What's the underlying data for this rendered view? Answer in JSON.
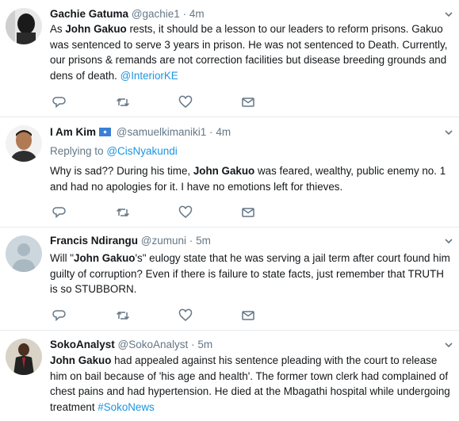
{
  "tweets": [
    {
      "name": "Gachie Gatuma",
      "handle": "@gachie1",
      "sep": "·",
      "time": "4m",
      "text_parts": [
        "As ",
        "John Gakuo",
        " rests, it should be a lesson to our leaders to reform prisons. Gakuo was sentenced to serve 3 years in prison. He was not sentenced to Death. Currently, our prisons & remands are not correction facilities but disease breeding grounds and dens of death. ",
        "@InteriorKE"
      ]
    },
    {
      "name": "I Am Kim",
      "handle": "@samuelkimaniki1",
      "sep": "·",
      "time": "4m",
      "replying_label": "Replying to",
      "replying_to": "@CisNyakundi",
      "text_parts": [
        "Why is sad?? During his time, ",
        "John Gakuo",
        " was feared, wealthy, public enemy no. 1 and had no apologies for it. I have no emotions left for thieves."
      ]
    },
    {
      "name": "Francis Ndirangu",
      "handle": "@zumuni",
      "sep": "·",
      "time": "5m",
      "text_parts": [
        "Will \"",
        "John Gakuo",
        "'s\" eulogy state that he was serving a jail term after court found him guilty of corruption? Even if there is failure to state facts, just remember that TRUTH is so STUBBORN."
      ]
    },
    {
      "name": "SokoAnalyst",
      "handle": "@SokoAnalyst",
      "sep": "·",
      "time": "5m",
      "text_parts": [
        "John Gakuo",
        " had appealed against his sentence pleading with the court to release him on bail because of 'his age and health'. The former town clerk had complained of chest pains and had hypertension. He died at the Mbagathi hospital while undergoing treatment ",
        "#SokoNews"
      ]
    }
  ],
  "icons": [
    "reply-icon",
    "retweet-icon",
    "like-icon",
    "message-icon",
    "chevron-down-icon"
  ],
  "colors": {
    "link": "#1b95e0",
    "muted": "#657786",
    "text": "#14171a",
    "border": "#e6ecf0"
  }
}
